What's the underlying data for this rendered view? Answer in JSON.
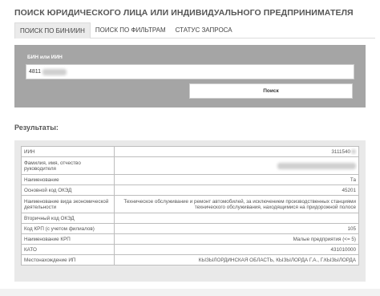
{
  "header": {
    "title": "ПОИСК ЮРИДИЧЕСКОГО ЛИЦА ИЛИ ИНДИВИДУАЛЬНОГО ПРЕДПРИНИМАТЕЛЯ"
  },
  "tabs": [
    {
      "label": "ПОИСК ПО БИН/ИИН",
      "active": true
    },
    {
      "label": "ПОИСК ПО ФИЛЬТРАМ",
      "active": false
    },
    {
      "label": "СТАТУС ЗАПРОСА",
      "active": false
    }
  ],
  "search": {
    "label": "БИН или ИИН",
    "value": "4811",
    "button": "Поиск"
  },
  "results": {
    "title": "Результаты:",
    "rows": [
      {
        "key": "ИИН",
        "value": "3111540"
      },
      {
        "key": "Фамилия, имя, отчество руководителя",
        "value": ""
      },
      {
        "key": "Наименование",
        "value": "Та"
      },
      {
        "key": "Основной код ОКЭД",
        "value": "45201"
      },
      {
        "key": "Наименование вида экономической деятельности",
        "value": "Техническое обслуживание и ремонт автомобилей, за исключением производственных станциями технического обслуживания, находящимися на придорожной полосе"
      },
      {
        "key": "Вторичный код ОКЭД",
        "value": ""
      },
      {
        "key": "Код КРП (с учетом филиалов)",
        "value": "105"
      },
      {
        "key": "Наименование КРП",
        "value": "Малые предприятия (<= 5)"
      },
      {
        "key": "КАТО",
        "value": "431010000"
      },
      {
        "key": "Местонахождение ИП",
        "value": "КЫЗЫЛОРДИНСКАЯ ОБЛАСТЬ, КЫЗЫЛОРДА Г.А., Г.КЫЗЫЛОРДА"
      }
    ]
  }
}
